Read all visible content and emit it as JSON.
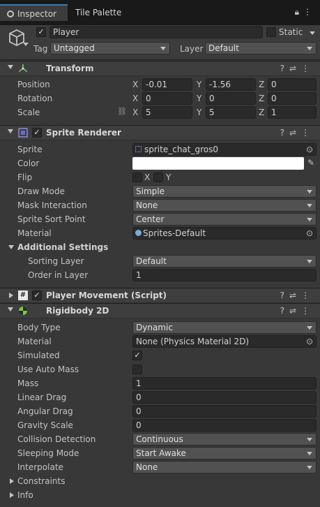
{
  "tabs": {
    "inspector": "Inspector",
    "tile_palette": "Tile Palette"
  },
  "header": {
    "name": "Player",
    "static_label": "Static",
    "tag_label": "Tag",
    "tag_value": "Untagged",
    "layer_label": "Layer",
    "layer_value": "Default"
  },
  "transform": {
    "title": "Transform",
    "position": {
      "label": "Position",
      "x": "-0.01",
      "y": "-1.56",
      "z": "0"
    },
    "rotation": {
      "label": "Rotation",
      "x": "0",
      "y": "0",
      "z": "0"
    },
    "scale": {
      "label": "Scale",
      "x": "5",
      "y": "5",
      "z": "1"
    },
    "axis_x": "X",
    "axis_y": "Y",
    "axis_z": "Z"
  },
  "sprite_renderer": {
    "title": "Sprite Renderer",
    "sprite_label": "Sprite",
    "sprite_value": "sprite_chat_gros0",
    "color_label": "Color",
    "color_value": "#ffffff",
    "flip_label": "Flip",
    "flip_x": "X",
    "flip_y": "Y",
    "draw_mode_label": "Draw Mode",
    "draw_mode_value": "Simple",
    "mask_label": "Mask Interaction",
    "mask_value": "None",
    "sort_point_label": "Sprite Sort Point",
    "sort_point_value": "Center",
    "material_label": "Material",
    "material_value": "Sprites-Default",
    "additional_label": "Additional Settings",
    "sorting_layer_label": "Sorting Layer",
    "sorting_layer_value": "Default",
    "order_label": "Order in Layer",
    "order_value": "1"
  },
  "player_movement": {
    "title": "Player Movement (Script)"
  },
  "rigidbody": {
    "title": "Rigidbody 2D",
    "body_type_label": "Body Type",
    "body_type_value": "Dynamic",
    "material_label": "Material",
    "material_value": "None (Physics Material 2D)",
    "simulated_label": "Simulated",
    "auto_mass_label": "Use Auto Mass",
    "mass_label": "Mass",
    "mass_value": "1",
    "linear_drag_label": "Linear Drag",
    "linear_drag_value": "0",
    "angular_drag_label": "Angular Drag",
    "angular_drag_value": "0",
    "gravity_label": "Gravity Scale",
    "gravity_value": "0",
    "collision_label": "Collision Detection",
    "collision_value": "Continuous",
    "sleeping_label": "Sleeping Mode",
    "sleeping_value": "Start Awake",
    "interpolate_label": "Interpolate",
    "interpolate_value": "None",
    "constraints_label": "Constraints",
    "info_label": "Info"
  },
  "colors": {
    "accent": "#3a79bb",
    "background": "#383838",
    "field": "#2a2a2a"
  }
}
